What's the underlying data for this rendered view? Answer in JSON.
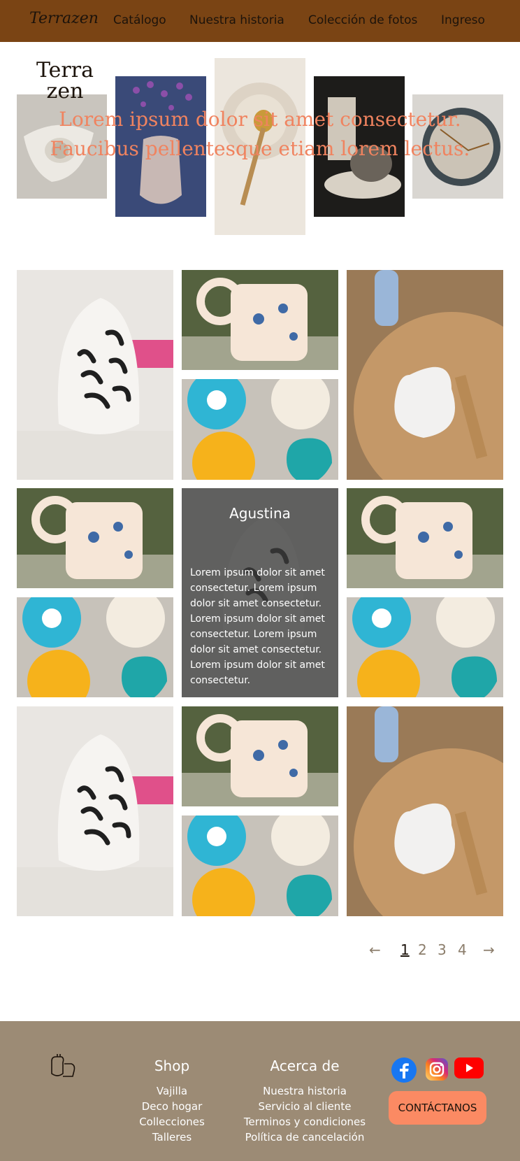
{
  "nav": {
    "logo": "Terrazen",
    "links": [
      "Catálogo",
      "Nuestra historia",
      "Colección de fotos",
      "Ingreso"
    ]
  },
  "hero": {
    "title": "Lorem ipsum dolor sit amet consectetur. Faucibus pellentesque etiam lorem lectus."
  },
  "card": {
    "title": "Agustina",
    "text": "Lorem ipsum dolor sit amet consectetur. Lorem ipsum dolor sit amet consectetur. Lorem ipsum dolor sit amet consectetur. Lorem ipsum dolor sit amet consectetur. Lorem ipsum dolor sit amet consectetur."
  },
  "pagination": {
    "prev": "←",
    "pages": [
      "1",
      "2",
      "3",
      "4"
    ],
    "next": "→",
    "current": "1"
  },
  "footer": {
    "logo_top": "Terra",
    "logo_bottom": "zen",
    "shop": {
      "heading": "Shop",
      "links": [
        "Vajilla",
        "Deco hogar",
        "Collecciones",
        "Talleres"
      ]
    },
    "about": {
      "heading": "Acerca de",
      "links": [
        "Nuestra historia",
        "Servicio al cliente",
        "Terminos y condiciones",
        "Política de cancelación"
      ]
    },
    "contact_label": "CONTÁCTANOS",
    "social_icons": [
      "facebook-icon",
      "instagram-icon",
      "youtube-icon"
    ]
  },
  "colors": {
    "nav_bg": "#7a4414",
    "hero_title": "#f0835f",
    "footer_bg": "#9c8b75",
    "contact_btn": "#fb8a63"
  }
}
